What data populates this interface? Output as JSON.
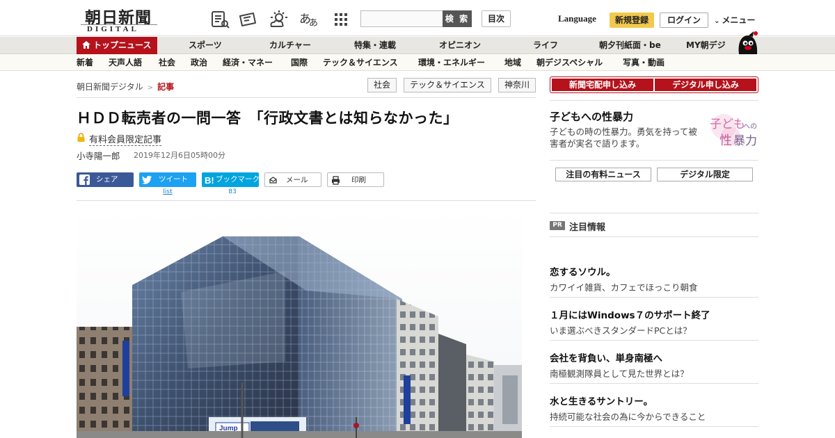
{
  "header": {
    "logo_main": "朝日新聞",
    "logo_sub": "DIGITAL",
    "font_size_glyph": "あ",
    "search_button": "検 索",
    "index_button": "目次",
    "language": "Language",
    "register": "新規登録",
    "login": "ログイン",
    "menu": "メニュー"
  },
  "nav_primary": [
    {
      "label": "トップニュース",
      "active": true
    },
    {
      "label": "スポーツ"
    },
    {
      "label": "カルチャー"
    },
    {
      "label": "特集・連載"
    },
    {
      "label": "オピニオン"
    },
    {
      "label": "ライフ"
    },
    {
      "label": "朝夕刊紙面・be"
    },
    {
      "label": "MY朝デジ"
    }
  ],
  "nav_secondary": [
    "新着",
    "天声人語",
    "社会",
    "政治",
    "経済・マネー",
    "国際",
    "テック＆サイエンス",
    "環境・エネルギー",
    "地域",
    "朝デジスペシャル",
    "写真・動画"
  ],
  "breadcrumb": {
    "home": "朝日新聞デジタル",
    "separator": ">",
    "current": "記事"
  },
  "tags": [
    "社会",
    "テック＆サイエンス",
    "神奈川"
  ],
  "article": {
    "title": "ＨＤＤ転売者の一問一答　「行政文書とは知らなかった」",
    "member_label": "有料会員限定記事",
    "author": "小寺陽一郎",
    "date": "2019年12月6日05時00分",
    "photo_sign": "Jump"
  },
  "share": {
    "facebook": "シェア",
    "twitter": "ツイート",
    "twitter_count": "list",
    "hatena": "ブックマーク",
    "hatena_count": "83",
    "mail": "メール",
    "print": "印刷"
  },
  "sidebar": {
    "subscribe_paper": "新聞宅配申し込み",
    "subscribe_digital": "デジタル申し込み",
    "feature_title": "子どもへの性暴力",
    "feature_desc": "子どもの時の性暴力。勇気を持って被害者が実名で語ります。",
    "feature_logo_1": "子ども",
    "feature_logo_2": "への",
    "feature_logo_3": "性",
    "feature_logo_4": "暴力",
    "tab_paid": "注目の有料ニュース",
    "tab_digital": "デジタル限定",
    "pr_badge": "PR",
    "pr_title": "注目情報",
    "pr_items": [
      {
        "title": "恋するソウル。",
        "desc": "カワイイ雑貨、カフェでほっこり朝食"
      },
      {
        "title": "１月にはWindows７のサポート終了",
        "desc": "いま選ぶべきスタンダードPCとは？"
      },
      {
        "title": "会社を背負い、単身南極へ",
        "desc": "南極観測隊員として見た世界とは？"
      },
      {
        "title": "水と生きるサントリー。",
        "desc": "持続可能な社会の為に今からできること"
      }
    ]
  },
  "colors": {
    "brand_red": "#b5121b",
    "register_yellow": "#f2c94c",
    "facebook": "#3b5998",
    "twitter": "#1da1f2",
    "hatena": "#00a4de"
  }
}
